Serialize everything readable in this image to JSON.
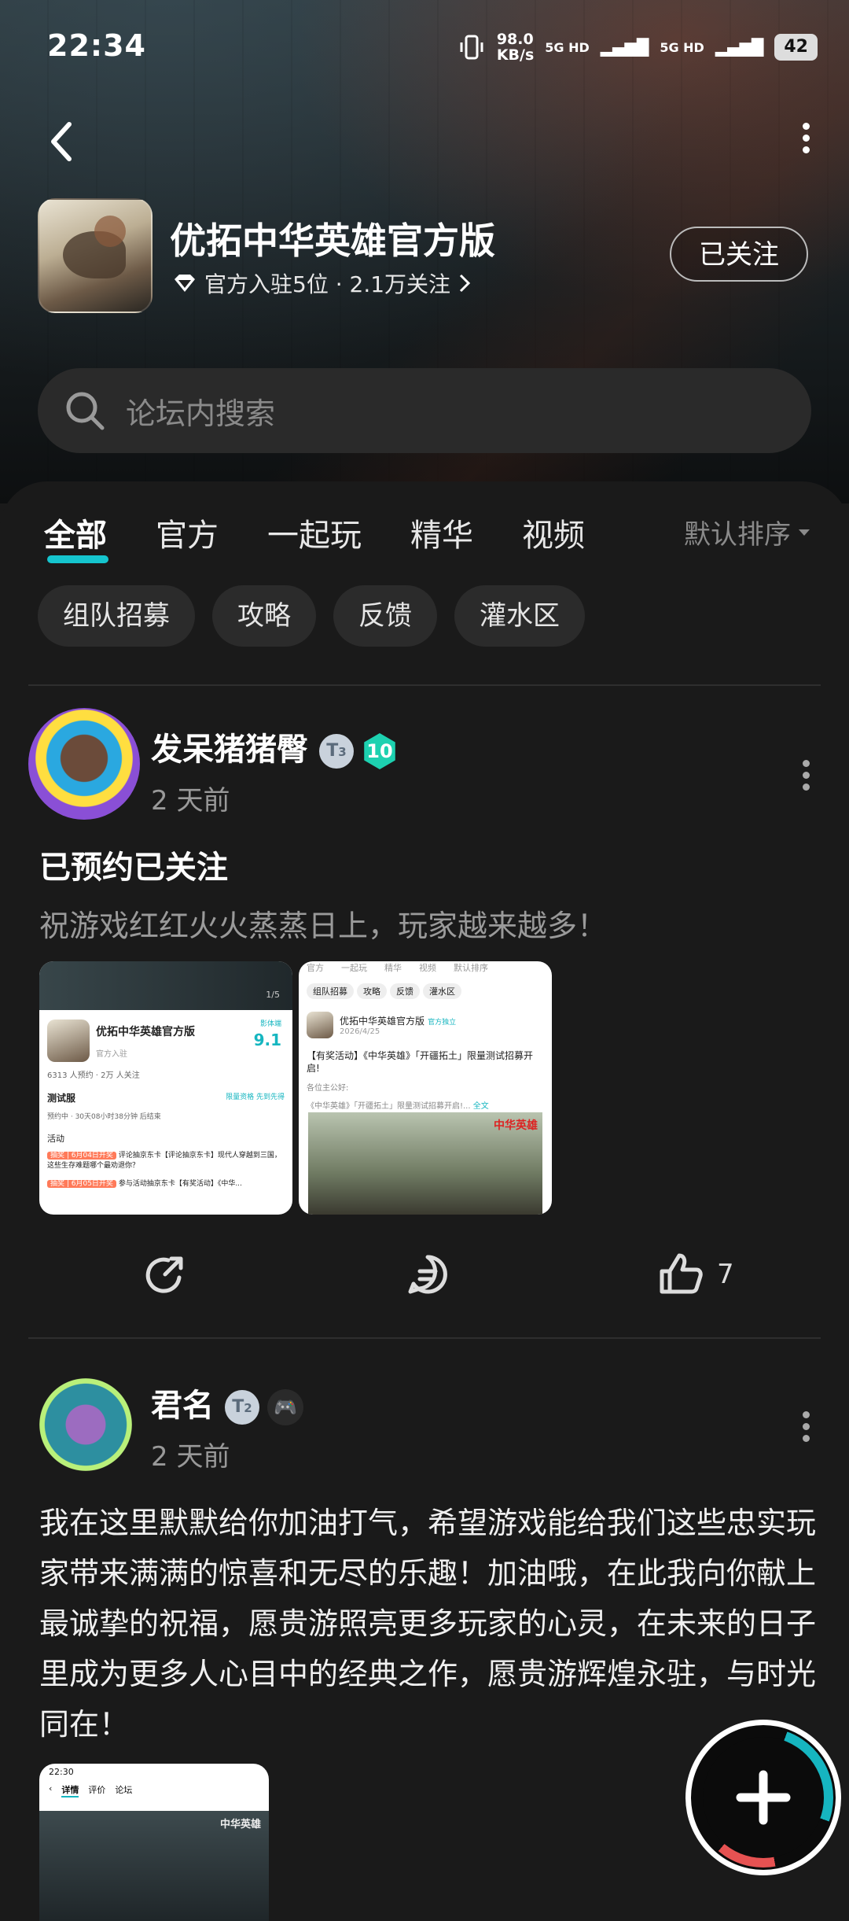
{
  "status_bar": {
    "time": "22:34",
    "speed": "98.0\nKB/s",
    "net1": "5G HD",
    "net2": "5G HD",
    "battery": "42"
  },
  "header": {
    "app_name": "优拓中华英雄官方版",
    "subtitle": "官方入驻5位 · 2.1万关注",
    "follow_label": "已关注",
    "search_placeholder": "论坛内搜索"
  },
  "tabs": [
    {
      "label": "全部",
      "active": true
    },
    {
      "label": "官方"
    },
    {
      "label": "一起玩"
    },
    {
      "label": "精华"
    },
    {
      "label": "视频"
    }
  ],
  "sort_label": "默认排序",
  "chips": [
    "组队招募",
    "攻略",
    "反馈",
    "灌水区"
  ],
  "posts": [
    {
      "user": "发呆猪猪臀",
      "badge_t": "3",
      "badge_level": "10",
      "time": "2 天前",
      "title": "已预约已关注",
      "body": "祝游戏红红火火蒸蒸日上，玩家越来越多！",
      "thumb1": {
        "name": "优拓中华英雄官方版",
        "score_label": "影体端",
        "score": "9.1",
        "official": "官方入驻",
        "stats": "6313 人预约 · 2万 人关注",
        "test_name": "测试服",
        "test_status": "预约中 · 30天08小时38分钟 后结束",
        "test_link": "限量资格 先到先得",
        "activity": "活动",
        "page": "1/5",
        "item1_tag": "抽奖 | 6月04日开奖",
        "item1_text": "评论抽京东卡【评论抽京东卡】现代人穿越到三国，这些生存难题哪个最劝退你？",
        "item2_tag": "抽奖 | 6月05日开奖",
        "item2_text": "参与活动抽京东卡【有奖活动】《中华..."
      },
      "thumb2": {
        "tabs": [
          "官方",
          "一起玩",
          "精华",
          "视频",
          "默认排序"
        ],
        "tags": [
          "组队招募",
          "攻略",
          "反馈",
          "灌水区"
        ],
        "name": "优拓中华英雄官方版",
        "official": "官方独立",
        "date": "2026/4/25",
        "headline": "【有奖活动】《中华英雄》「开疆拓土」限量测试招募开启!",
        "greeting": "各位主公好:",
        "teaser": "《中华英雄》「开疆拓土」限量测试招募开启!...",
        "more": "全文",
        "logo": "中华英雄"
      },
      "shares": "",
      "comments": "",
      "likes": "7"
    },
    {
      "user": "君名",
      "badge_t": "2",
      "time": "2 天前",
      "body": "我在这里默默给你加油打气，希望游戏能给我们这些忠实玩家带来满满的惊喜和无尽的乐趣！加油哦，在此我向你献上最诚挚的祝福，愿贵游照亮更多玩家的心灵，在未来的日子里成为更多人心目中的经典之作，愿贵游辉煌永驻，与时光同在！",
      "thumb": {
        "time": "22:30",
        "tab_detail": "详情",
        "tab_review": "评价",
        "tab_forum": "论坛",
        "logo": "中华英雄"
      }
    }
  ],
  "colors": {
    "accent": "#15c5ce",
    "level_badge": "#1dd1b0",
    "bg": "#1a1a1a"
  },
  "icons": [
    "back-icon",
    "more-icon",
    "diamond-icon",
    "chevron-right-icon",
    "search-icon",
    "sort-caret-icon",
    "share-icon",
    "comment-icon",
    "like-icon",
    "plus-icon"
  ]
}
